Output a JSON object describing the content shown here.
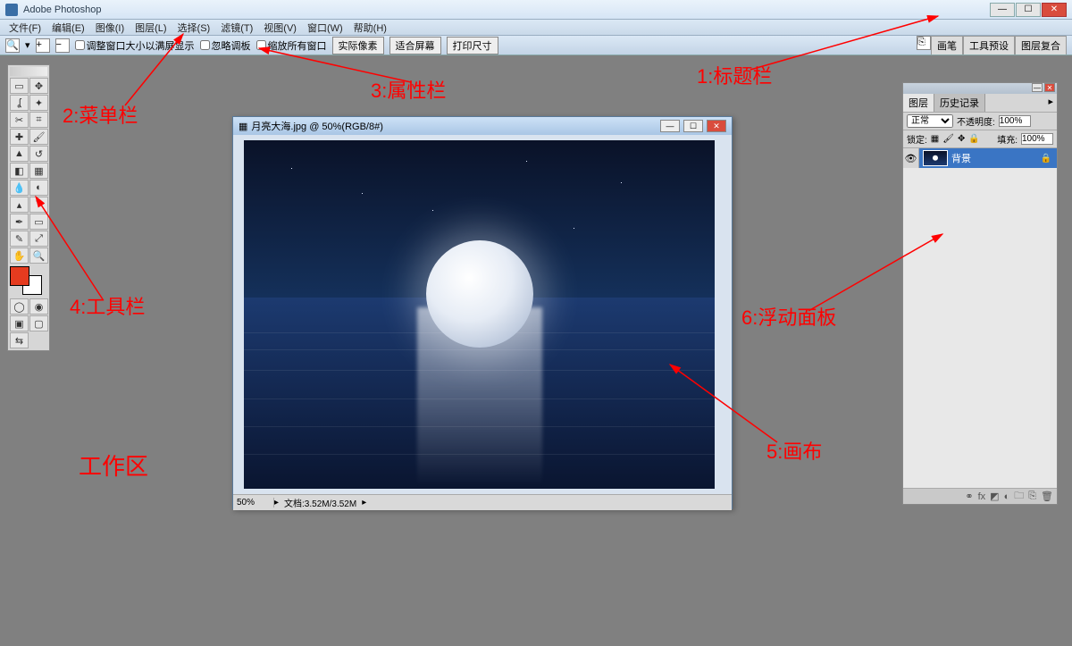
{
  "titlebar": {
    "app_name": "Adobe Photoshop"
  },
  "menu": {
    "file": "文件(F)",
    "edit": "编辑(E)",
    "image": "图像(I)",
    "layer": "图层(L)",
    "select": "选择(S)",
    "filter": "滤镜(T)",
    "view": "视图(V)",
    "window": "窗口(W)",
    "help": "帮助(H)"
  },
  "options": {
    "fit_window": "调整窗口大小以满屏显示",
    "ignore_palettes": "忽略调板",
    "zoom_all": "缩放所有窗口",
    "actual_pixels": "实际像素",
    "fit_screen": "适合屏幕",
    "print_size": "打印尺寸",
    "tab_brushes": "画笔",
    "tab_tool_presets": "工具预设",
    "tab_layer_comps": "图层复合"
  },
  "doc": {
    "title": "月亮大海.jpg @ 50%(RGB/8#)",
    "zoom": "50%",
    "doc_info": "文档:3.52M/3.52M"
  },
  "panel": {
    "tab_layers": "图层",
    "tab_history": "历史记录",
    "blend_mode": "正常",
    "opacity_label": "不透明度:",
    "opacity_value": "100%",
    "lock_label": "锁定:",
    "fill_label": "填充:",
    "fill_value": "100%",
    "layer_name": "背景"
  },
  "swatch": {
    "fg": "#e53b1f"
  },
  "annotations": {
    "a1": "1:标题栏",
    "a2": "2:菜单栏",
    "a3": "3:属性栏",
    "a4": "4:工具栏",
    "a5": "5:画布",
    "a6": "6:浮动面板",
    "work_area": "工作区"
  }
}
